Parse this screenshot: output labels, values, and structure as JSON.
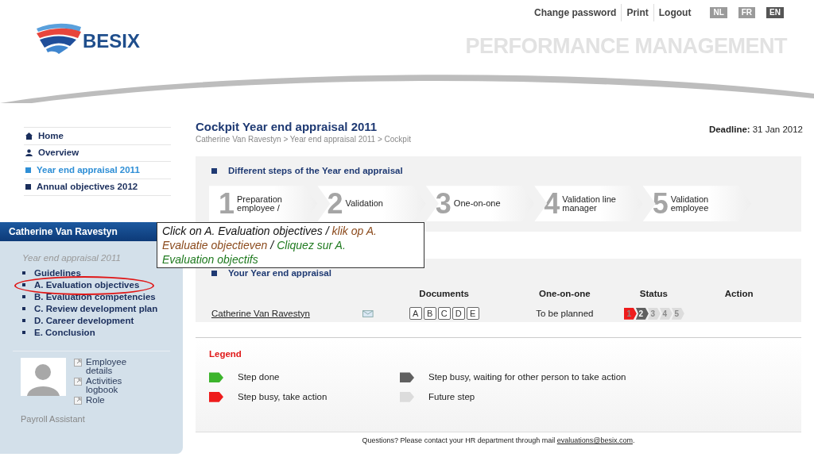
{
  "header": {
    "links": [
      "Change password",
      "Print",
      "Logout"
    ],
    "languages": [
      {
        "label": "NL",
        "selected": false
      },
      {
        "label": "FR",
        "selected": false
      },
      {
        "label": "EN",
        "selected": true
      }
    ],
    "logo": "BESIX",
    "app_title": "PERFORMANCE MANAGEMENT"
  },
  "nav": [
    {
      "label": "Home",
      "kind": "home",
      "selected": false
    },
    {
      "label": "Overview",
      "kind": "person",
      "selected": false
    },
    {
      "label": "Year end appraisal 2011",
      "kind": "square",
      "selected": true
    },
    {
      "label": "Annual objectives 2012",
      "kind": "square",
      "selected": false
    }
  ],
  "sidebar": {
    "title": "Catherine Van Ravestyn",
    "subtitle": "Year end appraisal 2011",
    "items": [
      {
        "label": "Guidelines",
        "highlighted": false
      },
      {
        "label": "A. Evaluation objectives",
        "highlighted": true
      },
      {
        "label": "B. Evaluation competencies",
        "highlighted": false
      },
      {
        "label": "C. Review development plan",
        "highlighted": false
      },
      {
        "label": "D. Career development",
        "highlighted": false
      },
      {
        "label": "E. Conclusion",
        "highlighted": false
      }
    ],
    "links": [
      "Employee details",
      "Activities logbook",
      "Role"
    ],
    "role": "Payroll Assistant"
  },
  "page": {
    "title": "Cockpit Year end appraisal 2011",
    "breadcrumb": "Catherine Van Ravestyn > Year end appraisal 2011 > Cockpit",
    "deadline_label": "Deadline:",
    "deadline": "31 Jan 2012"
  },
  "steps": {
    "heading": "Different steps of the Year end appraisal",
    "items": [
      {
        "number": "1",
        "label": "Preparation employee /"
      },
      {
        "number": "2",
        "label": "Validation"
      },
      {
        "number": "3",
        "label": "One-on-one"
      },
      {
        "number": "4",
        "label": "Validation line manager"
      },
      {
        "number": "5",
        "label": "Validation employee"
      }
    ]
  },
  "appraisal": {
    "heading": "Your Year end appraisal",
    "columns": [
      "Documents",
      "One-on-one",
      "Status",
      "Action"
    ],
    "rows": [
      {
        "name": "Catherine Van Ravestyn",
        "documents": [
          "A",
          "B",
          "C",
          "D",
          "E"
        ],
        "one_on_one": "To be planned",
        "status": [
          {
            "number": "1",
            "color": "#ee1c1c"
          },
          {
            "number": "2",
            "color": "#606060"
          },
          {
            "number": "3",
            "color": "#dcdcdc"
          },
          {
            "number": "4",
            "color": "#dcdcdc"
          },
          {
            "number": "5",
            "color": "#dcdcdc"
          }
        ]
      }
    ]
  },
  "legend": {
    "title": "Legend",
    "items": [
      {
        "label": "Step done",
        "color": "#3cb42c"
      },
      {
        "label": "Step busy, waiting for other person to take action",
        "color": "#606060"
      },
      {
        "label": "Step busy, take action",
        "color": "#ee1c1c"
      },
      {
        "label": "Future step",
        "color": "#dcdcdc"
      }
    ]
  },
  "footer": {
    "text": "Questions? Please contact your HR department through mail",
    "email": "evaluations@besix.com",
    "end": "."
  },
  "callout": {
    "lines": [
      {
        "segments": [
          {
            "text": "Click on A. Evaluation objectives /"
          },
          {
            "text": "klik op A.",
            "color": "#8b4a1c"
          }
        ]
      },
      {
        "segments": [
          {
            "text": "Evaluatie objectieven",
            "color": "#8b4a1c"
          },
          {
            "text": "/"
          },
          {
            "text": "Cliquez sur A.",
            "color": "#1f7a1f"
          }
        ]
      },
      {
        "segments": [
          {
            "text": "Evaluation objectifs",
            "color": "#1f7a1f"
          }
        ]
      }
    ]
  }
}
